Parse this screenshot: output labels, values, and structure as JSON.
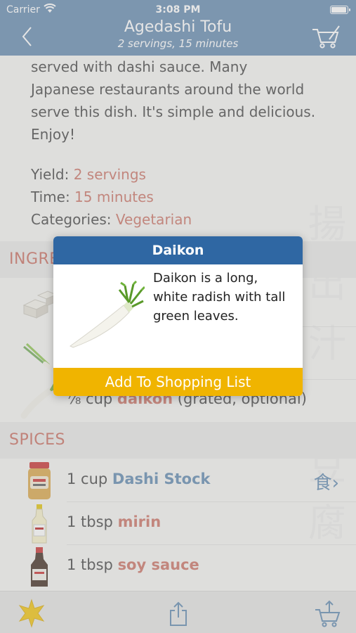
{
  "status_bar": {
    "carrier": "Carrier",
    "time": "3:08 PM"
  },
  "header": {
    "title": "Agedashi Tofu",
    "subtitle": "2 servings, 15 minutes",
    "back_icon": "chevron-left-icon",
    "cart_icon": "shopping-cart-icon"
  },
  "description": {
    "lines": [
      "served with dashi sauce. Many",
      "Japanese restaurants around the world",
      "serve this dish. It's simple and delicious.",
      "Enjoy!"
    ]
  },
  "meta": {
    "yield_label": "Yield:",
    "yield_value": "2 servings",
    "time_label": "Time:",
    "time_value": "15 minutes",
    "categories_label": "Categories:",
    "categories_value": "Vegetarian"
  },
  "ingredients": {
    "header": "INGRE",
    "last_row_fraction": "⅞",
    "last_row_unit": "cup",
    "last_row_name": "daikon",
    "last_row_note": "(grated, optional)"
  },
  "spices": {
    "header": "SPICES",
    "rows": [
      {
        "qty": "1 cup",
        "name": "Dashi Stock",
        "linked": true,
        "kanji": "食",
        "icon": "dashi-jar-icon"
      },
      {
        "qty": "1 tbsp",
        "name": "mirin",
        "linked": false,
        "icon": "mirin-bottle-icon"
      },
      {
        "qty": "1 tbsp",
        "name": "soy sauce",
        "linked": false,
        "icon": "soy-sauce-bottle-icon"
      }
    ]
  },
  "popover": {
    "title": "Daikon",
    "description": "Daikon is a long, white radish with tall green leaves.",
    "button": "Add To Shopping List",
    "image_icon": "daikon-radish-icon"
  },
  "toolbar": {
    "favorite_icon": "star-icon",
    "share_icon": "share-icon",
    "cart_icon": "shopping-cart-icon"
  },
  "colors": {
    "header_bg": "#5f86ad",
    "accent_red": "#c96e60",
    "link_blue": "#5a84ad",
    "popover_title_bg": "#2f67a3",
    "popover_button_bg": "#f0b400",
    "star_yellow": "#f2c200"
  }
}
